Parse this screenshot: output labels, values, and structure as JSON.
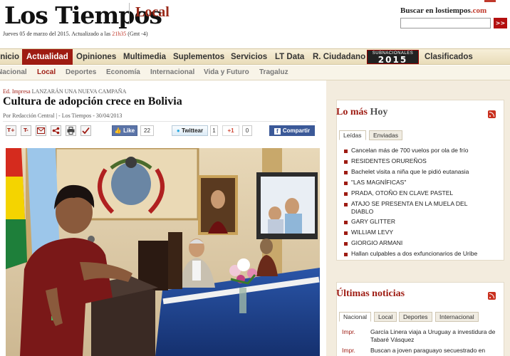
{
  "header": {
    "logo": "Los Tiempos",
    "section": "Local",
    "dateline_prefix": "Jueves 05 de marzo del 2015. Actualizado a las ",
    "dateline_time": "21h35",
    "dateline_suffix": " (Gmt -4)",
    "search_label": "Buscar en lostiempos",
    "search_label_tld": ".com",
    "search_placeholder": "",
    "search_button": ">>"
  },
  "mainnav": {
    "items": [
      "Inicio",
      "Actualidad",
      "Opiniones",
      "Multimedia",
      "Suplementos",
      "Servicios",
      "LT Data",
      "R. Ciudadano",
      "Clasificados"
    ],
    "active": "Actualidad",
    "badge_small": "SUBNACIONALES",
    "badge_big": "2015"
  },
  "subnav": {
    "items": [
      "Nacional",
      "Local",
      "Deportes",
      "Economía",
      "Internacional",
      "Vida y Futuro",
      "Tragaluz"
    ],
    "active": "Local"
  },
  "article": {
    "edition": "Ed. Impresa",
    "slug": "LANZARÁN UNA NUEVA CAMPAÑA",
    "headline": "Cultura de adopción crece en Bolivia",
    "byline": "Por Redacción Central | - Los Tiempos - 30/04/2013",
    "tools": [
      "T+",
      "T-",
      "mail",
      "share",
      "print",
      "check"
    ],
    "like_label": "Like",
    "like_count": "22",
    "tweet_label": "Twittear",
    "tweet_count": "1",
    "gplus_label": "+1",
    "gplus_count": "0",
    "share_label": "Compartir"
  },
  "sidebar": {
    "mas_hoy": {
      "title_red": "Lo más",
      "title_gray": "Hoy",
      "tabs": [
        "Leídas",
        "Enviadas"
      ],
      "items": [
        "Cancelan más de 700 vuelos por ola de frío",
        "RESIDENTES ORUREÑOS",
        "Bachelet visita a niña que le pidió eutanasia",
        "\"LAS MAGNÍFICAS\"",
        "PRADA, OTOÑO EN CLAVE PASTEL",
        "ATAJO SE PRESENTA EN LA MUELA DEL DIABLO",
        "GARY GLITTER",
        "WILLIAM LEVY",
        "GIORGIO ARMANI",
        "Hallan culpables a dos exfuncionarios de Uribe"
      ]
    },
    "ultimas": {
      "title": "Últimas noticias",
      "tabs": [
        "Nacional",
        "Local",
        "Deportes",
        "Internacional"
      ],
      "rows": [
        {
          "tag": "Impr.",
          "text": "García Linera viaja a Uruguay a investidura de Tabaré Vásquez"
        },
        {
          "tag": "Impr.",
          "text": "Buscan a joven paraguayo secuestrado en"
        }
      ]
    }
  },
  "colors": {
    "brand_red": "#9e1b12",
    "nav_bg": "#efe5c9",
    "sidebar_bg": "#f3ecde",
    "facebook_blue": "#3b5998"
  }
}
